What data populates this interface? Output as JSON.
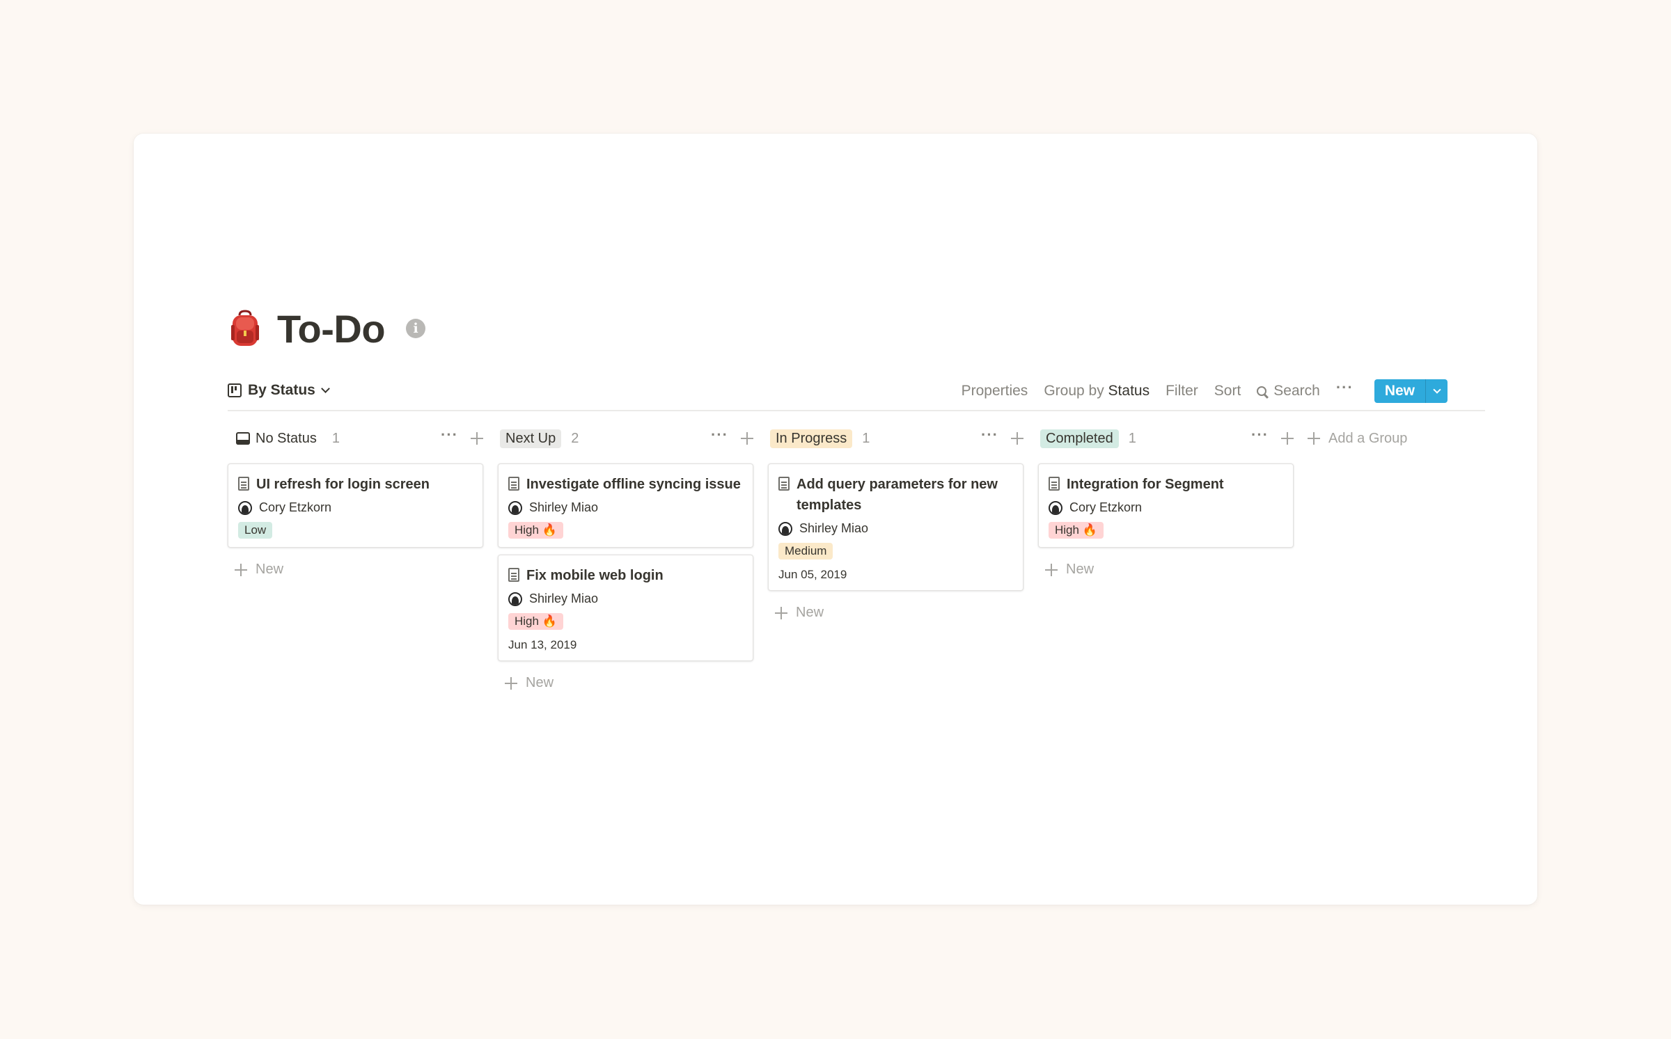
{
  "page": {
    "icon": "backpack-icon",
    "title": "To-Do",
    "info_icon": "info-icon"
  },
  "toolbar": {
    "view_label": "By Status",
    "properties": "Properties",
    "group_by_prefix": "Group by",
    "group_by_value": "Status",
    "filter": "Filter",
    "sort": "Sort",
    "search": "Search",
    "more": "···",
    "new": "New",
    "accent": "#2eaadc"
  },
  "columns": [
    {
      "name": "No Status",
      "count": "1",
      "tag_color": "transparent"
    },
    {
      "name": "Next Up",
      "count": "2",
      "tag_color": "#e9e9e7"
    },
    {
      "name": "In Progress",
      "count": "1",
      "tag_color": "#fbe9c9"
    },
    {
      "name": "Completed",
      "count": "1",
      "tag_color": "#d3ebe3"
    }
  ],
  "cards": {
    "c1": {
      "title": "UI refresh for login screen",
      "assignee": "Cory Etzkorn",
      "priority": "Low"
    },
    "c2": {
      "title": "Investigate offline syncing issue",
      "assignee": "Shirley Miao",
      "priority": "High 🔥"
    },
    "c3": {
      "title": "Fix mobile web login",
      "assignee": "Shirley Miao",
      "priority": "High 🔥",
      "date": "Jun 13, 2019"
    },
    "c4": {
      "title": "Add query parameters for new templates",
      "assignee": "Shirley Miao",
      "priority": "Medium",
      "date": "Jun 05, 2019"
    },
    "c5": {
      "title": "Integration for Segment",
      "assignee": "Cory Etzkorn",
      "priority": "High 🔥"
    }
  },
  "labels": {
    "new": "New",
    "add_group": "Add a Group",
    "dots": "···"
  }
}
